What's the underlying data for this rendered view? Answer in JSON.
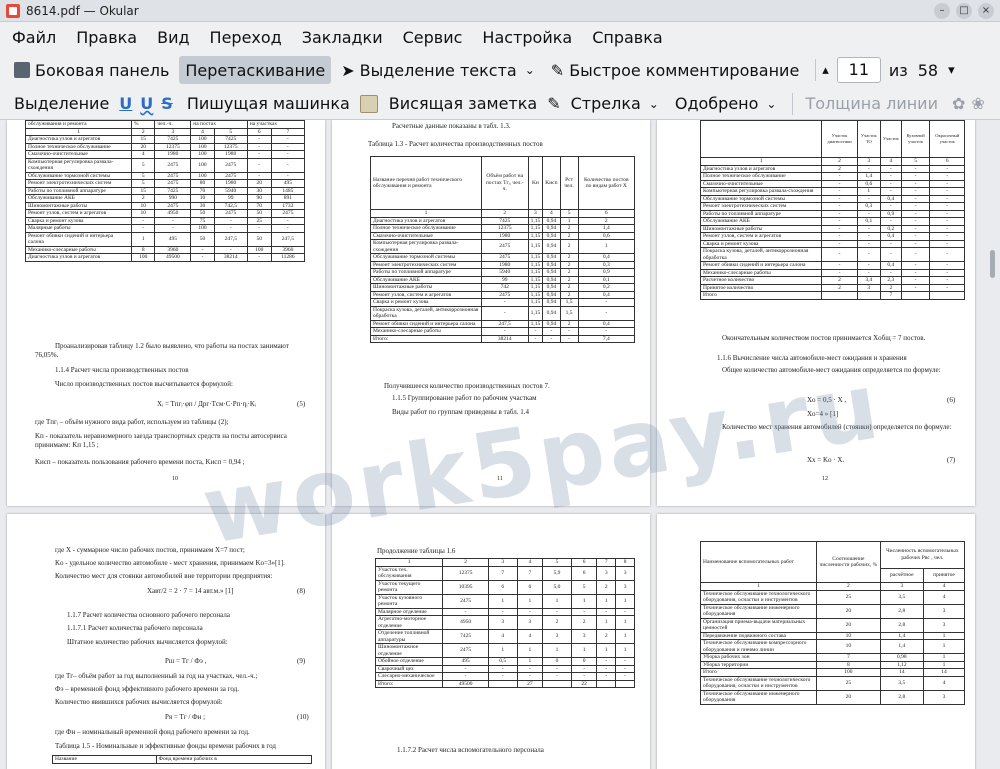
{
  "window": {
    "title": "8614.pdf — Okular"
  },
  "menu": [
    "Файл",
    "Правка",
    "Вид",
    "Переход",
    "Закладки",
    "Сервис",
    "Настройка",
    "Справка"
  ],
  "toolbar": {
    "sidebar": "Боковая панель",
    "drag": "Перетаскивание",
    "text_select": "Выделение текста",
    "quick_comment": "Быстрое комментирование",
    "page": "11",
    "of": "из",
    "total": "58"
  },
  "annot": {
    "highlight": "Выделение",
    "typewriter": "Пишущая машинка",
    "sticky": "Висящая заметка",
    "arrow": "Стрелка",
    "approved": "Одобрено",
    "line_width": "Толщина линии"
  },
  "watermark": "work5pay.ru",
  "p10": {
    "number": "10",
    "header": [
      "обслуживания и ремонта",
      "%",
      "чел.-ч.",
      "на постах",
      "на участках"
    ],
    "colnums": [
      "1",
      "2",
      "3",
      "4",
      "5",
      "6",
      "7"
    ],
    "rows": [
      [
        "Диагностика узлов и агрегатов",
        "15",
        "7425",
        "100",
        "7425",
        "-",
        "-"
      ],
      [
        "Полное техническое обслуживание",
        "20",
        "12375",
        "100",
        "12375",
        "-",
        "-"
      ],
      [
        "Смазочно-очистительные",
        "4",
        "1980",
        "100",
        "1980",
        "-",
        "-"
      ],
      [
        "Компьютерная регулировка развала-схождения",
        "5",
        "2475",
        "100",
        "2475",
        "-",
        "-"
      ],
      [
        "Обслуживание тормозной системы",
        "5",
        "2475",
        "100",
        "2475",
        "-",
        "-"
      ],
      [
        "Ремонт электротехнических систем",
        "5",
        "2475",
        "80",
        "1980",
        "20",
        "495"
      ],
      [
        "Работы по топливной аппаратуре",
        "15",
        "7425",
        "70",
        "5940",
        "30",
        "1485"
      ],
      [
        "Обслуживание АКБ",
        "2",
        "990",
        "10",
        "99",
        "90",
        "891"
      ],
      [
        "Шиномонтажные работы",
        "10",
        "2475",
        "30",
        "742,5",
        "70",
        "1733"
      ],
      [
        "Ремонт узлов, систем и агрегатов",
        "10",
        "4950",
        "50",
        "2475",
        "50",
        "2475"
      ],
      [
        "Сварка и ремонт кузова",
        "-",
        "-",
        "75",
        "-",
        "25",
        "-"
      ],
      [
        "Малярные работы",
        "-",
        "-",
        "100",
        "-",
        "-",
        "-"
      ],
      [
        "Ремонт обивки сидений и интерьера салона",
        "1",
        "495",
        "50",
        "247,5",
        "50",
        "247,5"
      ],
      [
        "Механико-слесарные работы",
        "8",
        "3960",
        "-",
        "-",
        "100",
        "3960"
      ],
      [
        "Диагностика узлов и агрегатов",
        "100",
        "49500",
        "-",
        "38214",
        "-",
        "11286"
      ]
    ],
    "para1": "Проанализировав таблицу 1.2 было выявлено, что работы на постах занимают 76,05%.",
    "sec": "1.1.4 Расчет числа производственных постов",
    "para2": "Число производственных постов высчитывается формулой:",
    "formula": "Xᵢ = Tпгᵢ·φп / Дрг·Tсм·C·Pп·ηᵢ·Kᵢ",
    "formula_num": "(5)",
    "def1": "где Tпгᵢ – объём нужного вида работ, используем из таблицы (2);",
    "def2": "Kп - показатель неравномерного заезда транспортных средств на посты автосервиса принимаем: Kп 1,15 ;",
    "def3": "Kисп – показатель пользования рабочего времени поста, Kисп = 0,94 ;"
  },
  "p11": {
    "number": "11",
    "intro": "Расчетные данные показаны в табл. 1.3.",
    "caption": "Таблица 1.3 - Расчет количества производственных постов",
    "header": [
      "Название перечня работ технического обслуживания и ремонта",
      "Объём работ на постах Tгᵢ, чел.-ч.",
      "Kн",
      "Kисп",
      "Pст чел.",
      "Количество постов по видам работ X"
    ],
    "colnums": [
      "1",
      "2",
      "3",
      "4",
      "5",
      "6"
    ],
    "rows": [
      [
        "Диагностика узлов и агрегатов",
        "7425",
        "1,15",
        "0,94",
        "1",
        "2"
      ],
      [
        "Полное техническое обслуживание",
        "12375",
        "1,15",
        "0,94",
        "2",
        "1,4"
      ],
      [
        "Смазочно-очистительные",
        "1980",
        "1,15",
        "0,94",
        "2",
        "0,6"
      ],
      [
        "Компьютерная регулировка развала-схождения",
        "2475",
        "1,15",
        "0,94",
        "2",
        "1"
      ],
      [
        "Обслуживание тормозной системы",
        "2475",
        "1,15",
        "0,94",
        "2",
        "0,4"
      ],
      [
        "Ремонт электротехнических систем",
        "1980",
        "1,15",
        "0,94",
        "2",
        "0,3"
      ],
      [
        "Работы по топливной аппаратуре",
        "5940",
        "1,15",
        "0,94",
        "2",
        "0,9"
      ],
      [
        "Обслуживание АКБ",
        "99",
        "1,15",
        "0,94",
        "2",
        "0,1"
      ],
      [
        "Шиномонтажные работы",
        "742",
        "1,15",
        "0,94",
        "2",
        "0,2"
      ],
      [
        "Ремонт узлов, систем и агрегатов",
        "2475",
        "1,15",
        "0,94",
        "2",
        "0,4"
      ],
      [
        "Сварка и ремонт кузова",
        "-",
        "1,15",
        "0,94",
        "1,5",
        "-"
      ],
      [
        "Покраска кузова, деталей, антикоррозионная обработка",
        "-",
        "1,15",
        "0,94",
        "1,5",
        "-"
      ],
      [
        "Ремонт обивки сидений и интерьера салона",
        "247,5",
        "1,15",
        "0,94",
        "2",
        "0,4"
      ],
      [
        "Механико-слесарные работы",
        "-",
        "-",
        "-",
        "-",
        "-"
      ],
      [
        "Итого:",
        "38214",
        "-",
        "-",
        "-",
        "7,4"
      ]
    ],
    "result": "Получившееся количество производственных постов 7.",
    "sec": "1.1.5 Группирование работ по рабочим участкам",
    "groups": "Виды работ по группам приведены в табл. 1.4"
  },
  "p12": {
    "number": "12",
    "colheads": [
      "Участок диагностики",
      "Участок ТО",
      "Участок",
      "Кузовной участок",
      "Окрасочный участок"
    ],
    "colnums": [
      "1",
      "2",
      "3",
      "4",
      "5",
      "6"
    ],
    "rows": [
      [
        "Диагностика узлов и агрегатов",
        "2",
        "-",
        "-",
        "-",
        "-"
      ],
      [
        "Полное техническое обслуживание",
        "-",
        "1,4",
        "-",
        "-",
        "-"
      ],
      [
        "Смазочно-очистительные",
        "-",
        "0,6",
        "-",
        "-",
        "-"
      ],
      [
        "Компьютерная регулировка развала-схождения",
        "-",
        "1",
        "-",
        "-",
        "-"
      ],
      [
        "Обслуживание тормозной системы",
        "-",
        "-",
        "0,4",
        "-",
        "-"
      ],
      [
        "Ремонт электротехнических систем",
        "-",
        "0,3",
        "-",
        "-",
        "-"
      ],
      [
        "Работы по топливной аппаратуре",
        "-",
        "-",
        "0,9",
        "-",
        "-"
      ],
      [
        "Обслуживание АКБ",
        "-",
        "0,1",
        "-",
        "-",
        "-"
      ],
      [
        "Шиномонтажные работы",
        "-",
        "-",
        "0,2",
        "-",
        "-"
      ],
      [
        "Ремонт узлов, систем и агрегатов",
        "-",
        "-",
        "0,4",
        "-",
        "-"
      ],
      [
        "Сварка и ремонт кузова",
        "-",
        "-",
        "-",
        "-",
        "-"
      ],
      [
        "Покраска кузова, деталей, антикоррозионная обработка",
        "-",
        "-",
        "-",
        "-",
        "-"
      ],
      [
        "Ремонт обивки сидений и интерьера салона",
        "-",
        "-",
        "0,4",
        "-",
        "-"
      ],
      [
        "Механико-слесарные работы",
        "-",
        "-",
        "-",
        "-",
        "-"
      ],
      [
        "Расчетное количество",
        "2",
        "3,4",
        "2,3",
        "-",
        "-"
      ],
      [
        "Принятое количество",
        "2",
        "3",
        "2",
        "-",
        "-"
      ],
      [
        "Итого",
        "",
        "",
        "7",
        "",
        ""
      ]
    ],
    "para1": "Окончательным количеством постов принимается Xобщ = 7 постов.",
    "sec": "1.1.6 Вычисление числа автомобиле-мест ожидания и хранения",
    "para2": "Общее количество автомобиле-мест ожидания определяется по формуле:",
    "f1": "Xо = 0,5 · X ,",
    "f1num": "(6)",
    "f2": "Xо=4 » [1]",
    "para3": "Количество мест хранения автомобилей (стоянки) определяется по формуле:",
    "f3": "Xх = Kо · X.",
    "f3num": "(7)"
  },
  "p13": {
    "l1": "где X - суммарное число рабочих постов, принимаем X=7 пост;",
    "l2": "Kо - удельное количество автомобиле - мест хранения, принимаем Kо=3»[1].",
    "l3": "Количество мест для стоянки автомобилей вне территории предприятия:",
    "f1": "Xавт/2 = 2 · 7 = 14 авт.м.» [1]",
    "f1num": "(8)",
    "s1": "1.1.7 Расчет количества основного рабочего персонала",
    "s2": "1.1.7.1 Расчет количества рабочего персонала",
    "l4": "Штатное количество рабочих вычисляется формулой:",
    "f2": "Pш = Tг / Фэ ,",
    "f2num": "(9)",
    "l5": "где Tг– объём работ за год выполненный за год на участках, чел.-ч.;",
    "l6": "Фэ – временной фонд эффективного рабочего времени за год.",
    "l7": "Количество явившихся рабочих вычисляется формулой:",
    "f3": "Pя = Tг / Фн ;",
    "f3num": "(10)",
    "l8": "где Фн – номинальный временной фонд рабочего времени за год.",
    "l9": "Таблица 1.5 - Номинальные и эффективные фонды времени рабочих в год",
    "th1": "Название",
    "th2": "Фонд времени рабочих в"
  },
  "p14": {
    "caption": "Продолжение таблицы 1.6",
    "colnums": [
      "1",
      "2",
      "3",
      "4",
      "5",
      "6",
      "7",
      "8"
    ],
    "rows": [
      [
        "Участок тех. обслуживания",
        "12375",
        "7",
        "7",
        "5,9",
        "6",
        "3",
        "3"
      ],
      [
        "Участок текущего ремонта",
        "10395",
        "6",
        "6",
        "5,0",
        "5",
        "2",
        "3"
      ],
      [
        "Участок кузовного ремонта",
        "2475",
        "1",
        "1",
        "1",
        "1",
        "1",
        "1"
      ],
      [
        "Малярное отделение",
        "-",
        "-",
        "-",
        "-",
        "-",
        "-",
        "-"
      ],
      [
        "Агрегатно-моторное отделение",
        "4950",
        "3",
        "3",
        "2",
        "2",
        "1",
        "1"
      ],
      [
        "Отделение топливной аппаратуры",
        "7425",
        "4",
        "4",
        "3",
        "3",
        "2",
        "1"
      ],
      [
        "Шиномонтажное отделение",
        "2475",
        "1",
        "1",
        "1",
        "1",
        "1",
        "1"
      ],
      [
        "Обойное отделение",
        "495",
        "0,5",
        "1",
        "0",
        "0",
        "-",
        "-"
      ],
      [
        "Сварочный цех",
        "-",
        "-",
        "-",
        "-",
        "-",
        "-",
        "-"
      ],
      [
        "Слесарно-механическое",
        "-",
        "-",
        "-",
        "-",
        "-",
        "-",
        "-"
      ],
      [
        "Итого:",
        "49500",
        "",
        "27",
        "",
        "22",
        "",
        ""
      ]
    ],
    "sec": "1.1.7.2 Расчет числа вспомогательного персонала"
  },
  "p15": {
    "header": [
      "Наименование вспомогательных работ",
      "Соотношение численности рабочих, %",
      "Численность вспомогательных рабочих Pвс , чел."
    ],
    "sub": [
      "расчётное",
      "принятое"
    ],
    "colnums": [
      "1",
      "2",
      "3",
      "4"
    ],
    "rows": [
      [
        "Техническое обслуживание технологического оборудования, оснастки и инструментов",
        "25",
        "3,5",
        "4"
      ],
      [
        "Техническое обслуживание инженерного оборудования",
        "20",
        "2,8",
        "3"
      ],
      [
        "Организация приема-выдачи материальных ценностей",
        "20",
        "2,8",
        "3"
      ],
      [
        "Передвижение подвижного состава",
        "10",
        "1,4",
        "1"
      ],
      [
        "Техническое обслуживание компрессорного оборудования и пневмо линии",
        "10",
        "1,4",
        "1"
      ],
      [
        "Уборка рабочих зон",
        "7",
        "0,98",
        "1"
      ],
      [
        "Уборка территории",
        "8",
        "1,12",
        "1"
      ],
      [
        "Итого",
        "100",
        "14",
        "14"
      ],
      [
        "Техническое обслуживание технологического оборудования, оснастки и инструментов",
        "25",
        "3,5",
        "4"
      ],
      [
        "Техническое обслуживание инженерного оборудования",
        "20",
        "2,8",
        "3"
      ]
    ]
  }
}
